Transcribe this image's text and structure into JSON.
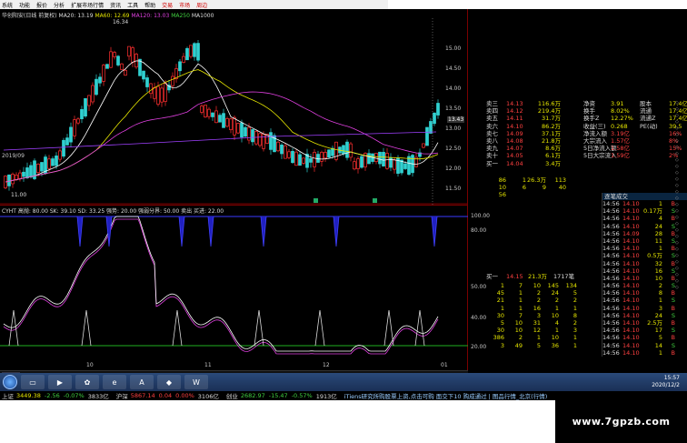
{
  "menu": {
    "items": [
      "系统",
      "功能",
      "报价",
      "分析",
      "扩展市场行情",
      "资讯",
      "工具",
      "帮助"
    ],
    "hot": [
      "交易",
      "市场",
      "周边"
    ]
  },
  "chart": {
    "title_left": "华创阳安(日线 前复权)",
    "ma_labels": [
      "MA20: 13.19",
      "MA60: 12.69",
      "MA120: 13.03",
      "MA250",
      "MA1000"
    ],
    "high_label": "16.34",
    "low_label": "11.00",
    "price_now": "13.43",
    "yaxis": [
      "15.00",
      "14.50",
      "14.00",
      "13.50",
      "13.00",
      "12.50",
      "12.00",
      "11.50"
    ],
    "date_label": "2019/09"
  },
  "indicator": {
    "title": "CYHT 高抛: 80.00  SK: 39.10  SD: 33.25  强势: 20.00  强弱分界: 50.00  卖出  买进: 22.00",
    "yaxis": [
      "100.00",
      "80.00",
      "50.00",
      "40.00",
      "20.00"
    ],
    "dates": [
      "10",
      "11",
      "12",
      "01"
    ]
  },
  "tabs_row1": [
    "指标A",
    "窗口",
    "MACD",
    "DMI",
    "DMA",
    "FSL",
    "TRIX",
    "BRAR",
    "CR",
    "VR",
    "OBV",
    "ASI",
    "EMV",
    "VOL-TDX",
    "RSI",
    "WR",
    "SAR",
    "KDJ",
    "CCI",
    "ROC",
    "MTM",
    "BOLL",
    "PSY",
    "MCST",
    "更多",
    "设置"
  ],
  "tabs_row2": [
    "扩展A",
    "大单数据",
    "资金流向",
    "资金分布",
    "行业资讯",
    "行业数据",
    "互动问答",
    "机构研报",
    "扫描板"
  ],
  "right": {
    "book_labels": [
      "卖三",
      "卖四",
      "卖五",
      "卖六",
      "卖七",
      "卖八",
      "卖九",
      "卖十",
      "买一"
    ],
    "book_prices": [
      "14.13",
      "14.12",
      "14.11",
      "14.10",
      "14.09",
      "14.08",
      "14.07",
      "14.05",
      "14.04"
    ],
    "book_vols": [
      "116.6万",
      "219.4万",
      "31.7万",
      "86.2万",
      "37.1万",
      "21.8万",
      "8.6万",
      "6.1万",
      "3.4万"
    ],
    "stats": [
      {
        "l": "净资",
        "v": "3.91",
        "l2": "股本",
        "v2": "17.4亿"
      },
      {
        "l": "换手",
        "v": "8.02%",
        "l2": "流通",
        "v2": "17.4亿"
      },
      {
        "l": "换手Z",
        "v": "12.27%",
        "l2": "流通Z",
        "v2": "17.4亿"
      },
      {
        "l": "收益(三)",
        "v": "0.268",
        "l2": "PE(动)",
        "v2": "39.5"
      },
      {
        "l": "净流入额",
        "v": "3.19亿",
        "l2": "",
        "v2": "16%"
      },
      {
        "l": "大宗流入",
        "v": "1.57亿",
        "l2": "",
        "v2": "8%"
      },
      {
        "l": "5日净流入额",
        "v": "1.58亿",
        "l2": "",
        "v2": "15%"
      },
      {
        "l": "5日大宗流入",
        "v": "1.59亿",
        "l2": "",
        "v2": "2%"
      }
    ],
    "mini_rows": [
      [
        "86",
        "1",
        "26.3万",
        "113"
      ],
      [
        "10",
        "6",
        "9",
        "40"
      ],
      [
        "56",
        "",
        "",
        ""
      ]
    ],
    "ticks_header": "逐笔成交",
    "ticks": [
      [
        "14:56",
        "14.10",
        "1",
        "B"
      ],
      [
        "14:56",
        "14.10",
        "0.17万",
        "S"
      ],
      [
        "14:56",
        "14.10",
        "4",
        "B"
      ],
      [
        "14:56",
        "14.10",
        "24",
        "S"
      ],
      [
        "14:56",
        "14.09",
        "28",
        "B"
      ],
      [
        "14:56",
        "14.10",
        "11",
        "S"
      ],
      [
        "14:56",
        "14.10",
        "1",
        "B"
      ],
      [
        "14:56",
        "14.10",
        "0.5万",
        "S"
      ],
      [
        "14:56",
        "14.10",
        "32",
        "B"
      ],
      [
        "14:56",
        "14.10",
        "16",
        "S"
      ],
      [
        "14:56",
        "14.10",
        "10",
        "B"
      ],
      [
        "14:56",
        "14.10",
        "2",
        "S"
      ],
      [
        "14:56",
        "14.10",
        "8",
        "B"
      ],
      [
        "14:56",
        "14.10",
        "1",
        "S"
      ],
      [
        "14:56",
        "14.10",
        "3",
        "B"
      ],
      [
        "14:56",
        "14.10",
        "24",
        "S"
      ],
      [
        "14:56",
        "14.10",
        "2.5万",
        "B"
      ],
      [
        "14:56",
        "14.10",
        "17",
        "S"
      ],
      [
        "14:56",
        "14.10",
        "5",
        "B"
      ],
      [
        "14:56",
        "14.10",
        "14",
        "S"
      ],
      [
        "14:56",
        "14.10",
        "1",
        "B"
      ]
    ],
    "buy_summary": [
      "买一",
      "14.15",
      "21.3万",
      "1717笔"
    ],
    "buy_grid": [
      [
        "1",
        "7",
        "10",
        "145",
        "134"
      ],
      [
        "45",
        "1",
        "2",
        "24",
        "5"
      ],
      [
        "21",
        "1",
        "2",
        "2",
        "2"
      ],
      [
        "1",
        "1",
        "16",
        "1",
        "1"
      ],
      [
        "30",
        "7",
        "3",
        "10",
        "8"
      ],
      [
        "5",
        "10",
        "31",
        "4",
        "2"
      ],
      [
        "30",
        "10",
        "12",
        "1",
        "3"
      ],
      [
        "386",
        "2",
        "1",
        "10",
        "1"
      ],
      [
        "3",
        "49",
        "5",
        "36",
        "1"
      ]
    ]
  },
  "status": {
    "sh_name": "上证",
    "sh_val": "3449.38",
    "sh_chg": "-2.56",
    "sh_pct": "-0.07%",
    "sh_amt": "3833亿",
    "hs_name": "沪深",
    "hs_val": "5867.14",
    "hs_chg": "0.04",
    "hs_pct": "0.00%",
    "hs_amt": "3106亿",
    "cy_name": "创业",
    "cy_val": "2682.97",
    "cy_chg": "-15.47",
    "cy_pct": "-0.57%",
    "cy_amt": "1913亿",
    "scroll": "iTiens研究所购股票上资,点击可购 面交下10 购成通过 | 图品行情_北京(行情)"
  },
  "clock": {
    "time": "15:57",
    "date": "2020/12/2"
  },
  "watermark": "www.7gpzb.com"
}
